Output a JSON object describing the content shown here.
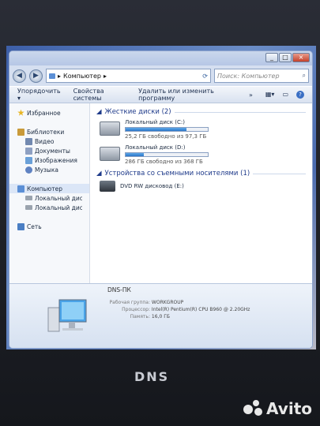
{
  "window": {
    "controls": [
      "_",
      "□",
      "×"
    ]
  },
  "address": {
    "path_item": "Компьютер",
    "arrow": "▸",
    "search_placeholder": "Поиск: Компьютер"
  },
  "toolbar": {
    "organize": "Упорядочить ▾",
    "properties": "Свойства системы",
    "uninstall": "Удалить или изменить программу",
    "more": "»"
  },
  "sidebar": {
    "items": [
      {
        "label": "Избранное",
        "icon": "star-icon",
        "color": "#e8b524"
      },
      {
        "label": "Библиотеки",
        "icon": "library-icon",
        "color": "#c99a3a"
      },
      {
        "label": "Видео",
        "icon": "video-icon",
        "color": "#7289b0"
      },
      {
        "label": "Документы",
        "icon": "documents-icon",
        "color": "#8ea0c2"
      },
      {
        "label": "Изображения",
        "icon": "images-icon",
        "color": "#6aa0d8"
      },
      {
        "label": "Музыка",
        "icon": "music-icon",
        "color": "#5f82c2"
      },
      {
        "label": "Компьютер",
        "icon": "computer-icon",
        "color": "#5b8fd6"
      },
      {
        "label": "Локальный диск (C:)",
        "icon": "drive-icon",
        "color": "#9aa3ae"
      },
      {
        "label": "Локальный диск (D:)",
        "icon": "drive-icon",
        "color": "#9aa3ae"
      },
      {
        "label": "Сеть",
        "icon": "network-icon",
        "color": "#4b7fc4"
      }
    ]
  },
  "content": {
    "hard_drives_header": "Жесткие диски (2)",
    "drives": [
      {
        "name": "Локальный диск (C:)",
        "free": "25,2 ГБ свободно из 97,3 ГБ",
        "used_fraction": 0.74
      },
      {
        "name": "Локальный диск (D:)",
        "free": "286 ГБ свободно из 368 ГБ",
        "used_fraction": 0.22
      }
    ],
    "removable_header": "Устройства со съемными носителями (1)",
    "dvd": "DVD RW дисковод (E:)"
  },
  "details": {
    "pc_name": "DNS-ПК",
    "rows": [
      {
        "label": "Рабочая группа:",
        "value": "WORKGROUP"
      },
      {
        "label": "Процессор:",
        "value": "Intel(R) Pentium(R) CPU B960 @ 2.20GHz"
      },
      {
        "label": "Память:",
        "value": "16,0 ГБ"
      }
    ]
  },
  "bezel": {
    "brand": "DNS"
  },
  "watermark": {
    "text": "Avito"
  }
}
